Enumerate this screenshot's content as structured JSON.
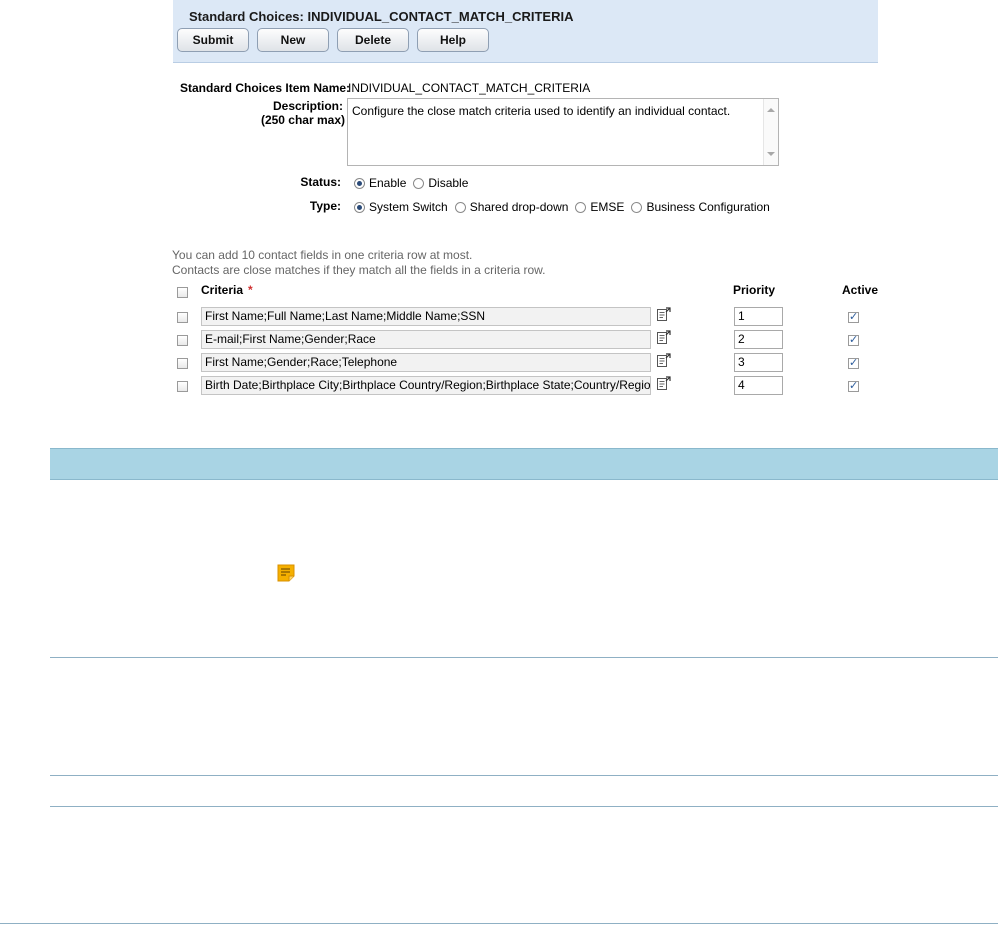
{
  "header": {
    "title": "Standard Choices: INDIVIDUAL_CONTACT_MATCH_CRITERIA",
    "buttons": {
      "submit": "Submit",
      "new": "New",
      "delete": "Delete",
      "help": "Help"
    }
  },
  "form": {
    "item_name_label": "Standard Choices Item Name:",
    "item_name_value": "INDIVIDUAL_CONTACT_MATCH_CRITERIA",
    "description_label": "Description:",
    "description_hint": "(250 char max)",
    "description_value": "Configure the close match criteria used to identify an individual contact.",
    "status_label": "Status:",
    "status_options": [
      "Enable",
      "Disable"
    ],
    "status_selected": "Enable",
    "type_label": "Type:",
    "type_options": [
      "System Switch",
      "Shared drop-down",
      "EMSE",
      "Business Configuration"
    ],
    "type_selected": "System Switch"
  },
  "hints": [
    "You can add 10 contact fields in one criteria row at most.",
    "Contacts are close matches if they match all the fields in a criteria row."
  ],
  "criteria_table": {
    "headers": {
      "criteria": "Criteria",
      "required_mark": "*",
      "priority": "Priority",
      "active": "Active"
    },
    "rows": [
      {
        "criteria": "First Name;Full Name;Last Name;Middle Name;SSN",
        "priority": "1",
        "active": true
      },
      {
        "criteria": "E-mail;First Name;Gender;Race",
        "priority": "2",
        "active": true
      },
      {
        "criteria": "First Name;Gender;Race;Telephone",
        "priority": "3",
        "active": true
      },
      {
        "criteria": "Birth Date;Birthplace City;Birthplace Country/Region;Birthplace State;Country/Region;R",
        "priority": "4",
        "active": true
      }
    ]
  },
  "icons": {
    "edit": "edit-list-icon",
    "note": "note-icon"
  },
  "colors": {
    "header_bg": "#dce8f6",
    "table_band": "#a9d4e4",
    "note_icon": "#f5b000"
  }
}
